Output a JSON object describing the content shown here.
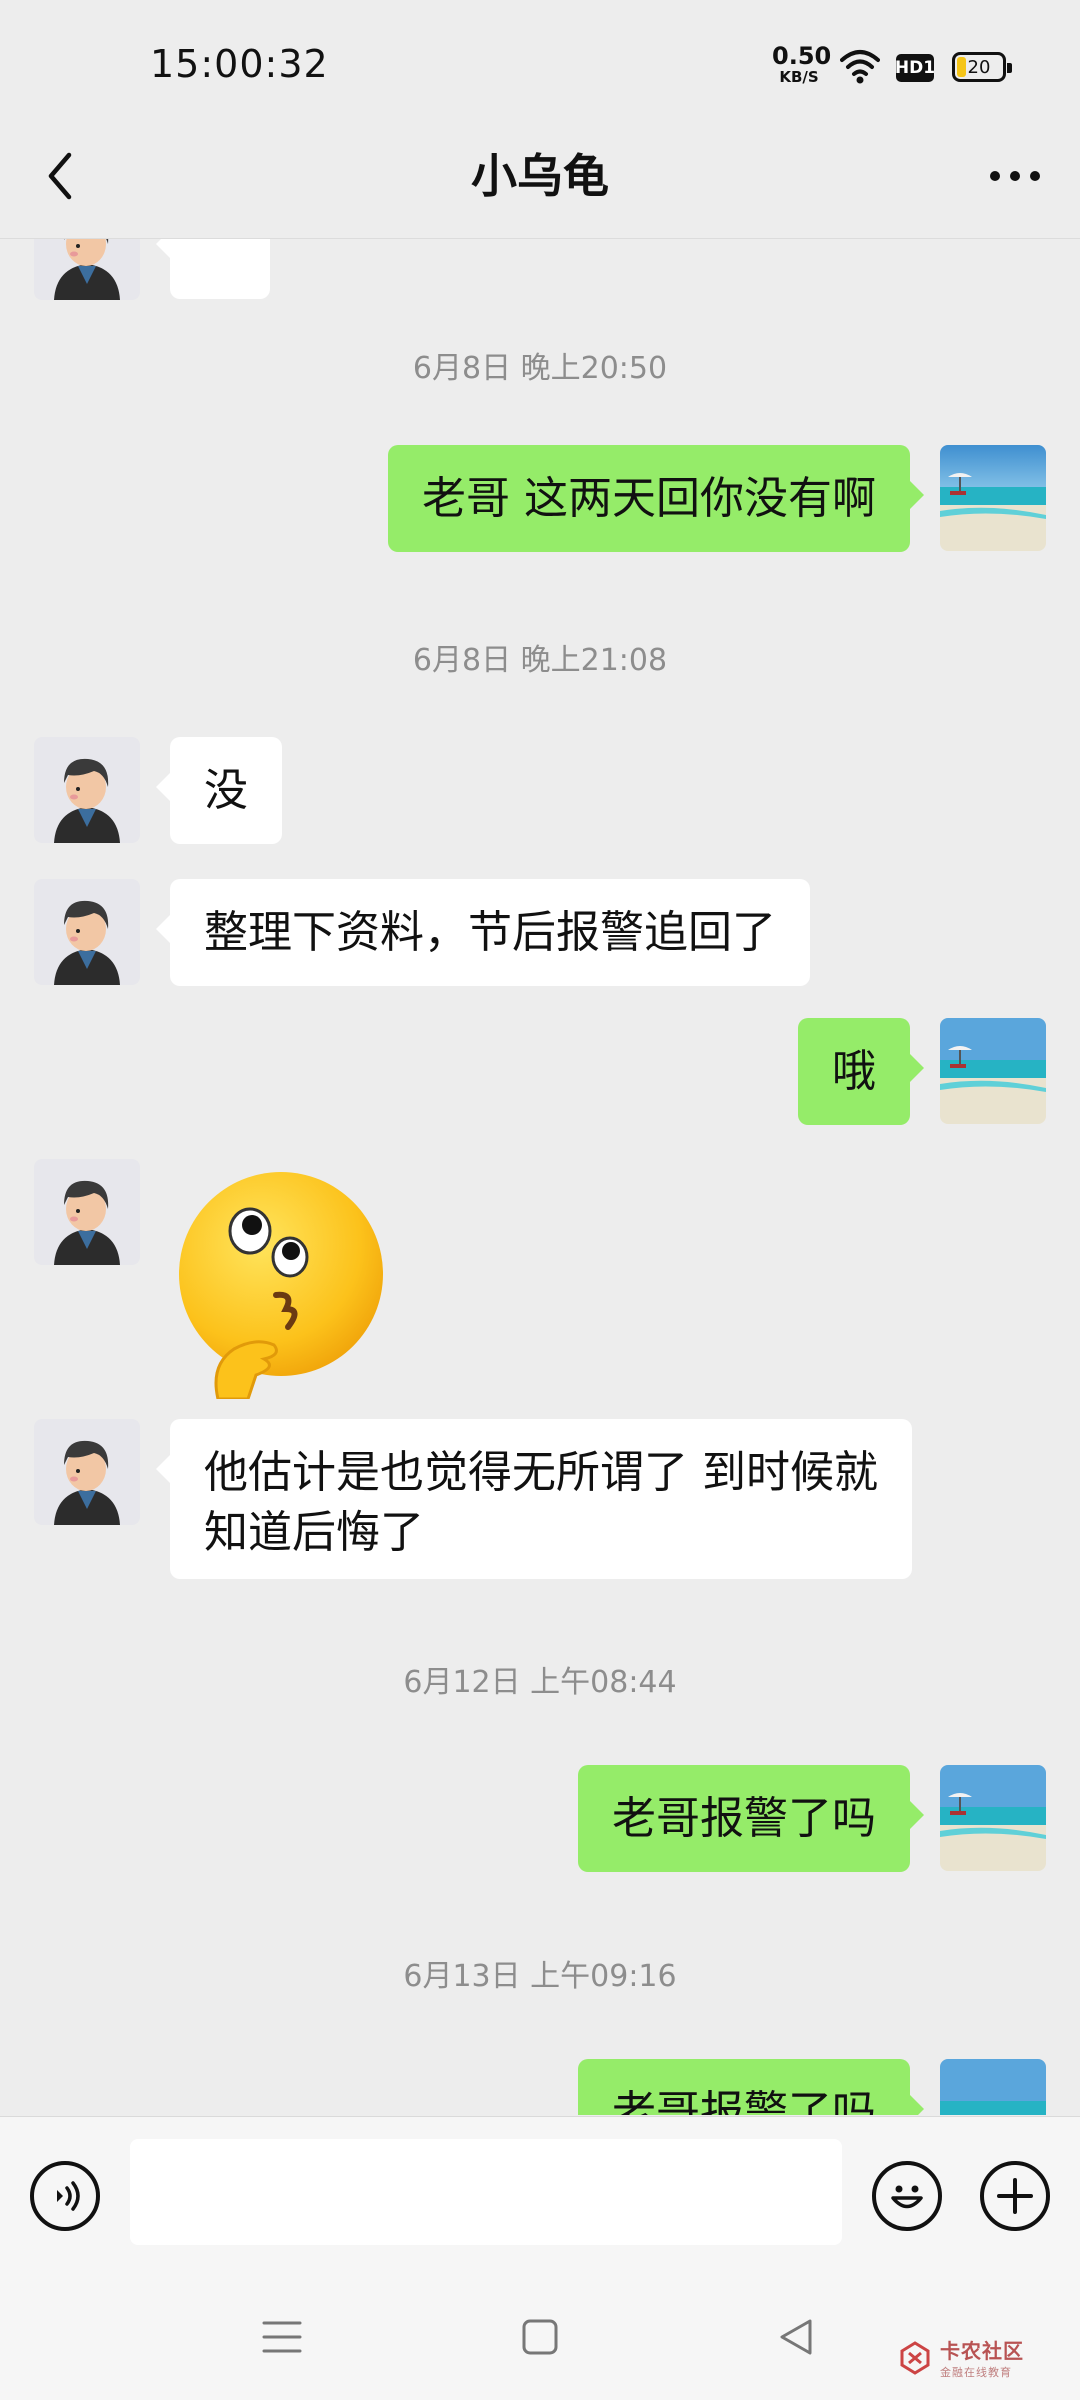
{
  "status_bar": {
    "time": "15:00:32",
    "net_speed_value": "0.50",
    "net_speed_unit": "KB/S",
    "hd_badge": "HD1",
    "battery_level": "20"
  },
  "header": {
    "title": "小乌龟"
  },
  "messages": [
    {
      "kind": "timestamp",
      "text": "6月8日 晚上20:50"
    },
    {
      "kind": "out",
      "text": "老哥 这两天回你没有啊"
    },
    {
      "kind": "timestamp",
      "text": "6月8日 晚上21:08"
    },
    {
      "kind": "in",
      "text": "没"
    },
    {
      "kind": "in",
      "text": "整理下资料，节后报警追回了"
    },
    {
      "kind": "out",
      "text": "哦"
    },
    {
      "kind": "in_sticker",
      "sticker": "thinking-face-emoji"
    },
    {
      "kind": "in",
      "text": "他估计是也觉得无所谓了 到时候就知道后悔了"
    },
    {
      "kind": "timestamp",
      "text": "6月12日 上午08:44"
    },
    {
      "kind": "out",
      "text": "老哥报警了吗"
    },
    {
      "kind": "timestamp",
      "text": "6月13日 上午09:16"
    },
    {
      "kind": "out",
      "text": "老哥报警了吗"
    }
  ],
  "watermark": {
    "name": "卡农社区",
    "tagline": "金融在线教育"
  },
  "colors": {
    "background": "#ededed",
    "outgoing_bubble": "#95ec69",
    "incoming_bubble": "#ffffff"
  }
}
